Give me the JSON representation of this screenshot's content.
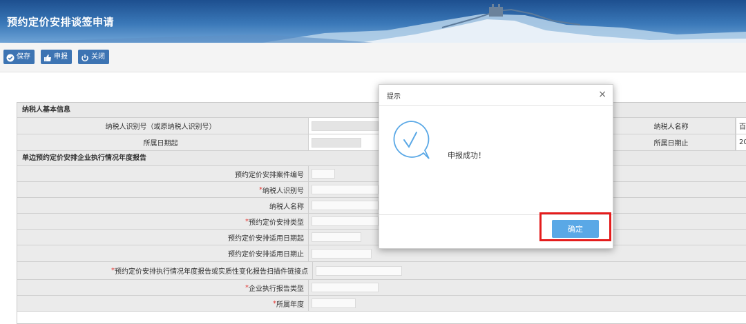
{
  "header": {
    "title": "预约定价安排谈签申请"
  },
  "toolbar": {
    "save": "保存",
    "report": "申报",
    "close": "关闭"
  },
  "taxpayer_section": {
    "title": "纳税人基本信息",
    "id_label": "纳税人识别号（或原纳税人识别号）",
    "name_label": "纳税人名称",
    "name_value_partial": "百",
    "period_start_label": "所属日期起",
    "period_end_label": "所属日期止",
    "period_end_value_partial": "20"
  },
  "report_section": {
    "title": "单边预约定价安排企业执行情况年度报告",
    "fields": [
      {
        "label": "预约定价安排案件编号",
        "required": false
      },
      {
        "label": "纳税人识别号",
        "required": true
      },
      {
        "label": "纳税人名称",
        "required": false
      },
      {
        "label": "预约定价安排类型",
        "required": true
      },
      {
        "label": "预约定价安排适用日期起",
        "required": false
      },
      {
        "label": "预约定价安排适用日期止",
        "required": false
      },
      {
        "label": "预约定价安排执行情况年度报告或实质性变化报告扫描件链接点",
        "required": true
      },
      {
        "label": "企业执行报告类型",
        "required": true
      },
      {
        "label": "所属年度",
        "required": true
      }
    ]
  },
  "dialog": {
    "title": "提示",
    "close_symbol": "×",
    "message": "申报成功！",
    "ok": "确定"
  },
  "colors": {
    "banner": "#3a78b8",
    "toolbar_button": "#3d74b3",
    "ok_button": "#5aa8e6",
    "highlight": "#e41c1c",
    "required": "#e53935"
  }
}
